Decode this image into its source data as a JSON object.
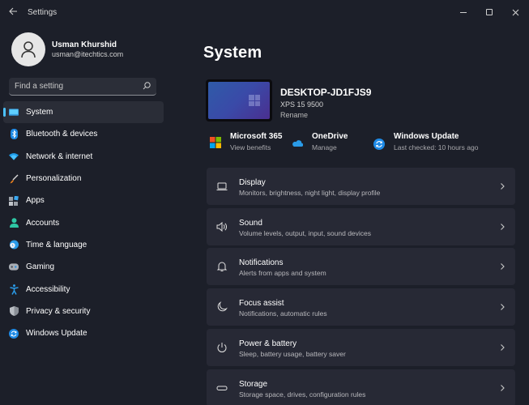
{
  "window": {
    "title": "Settings",
    "controls": {
      "minimize": "minimize",
      "maximize": "maximize",
      "close": "close"
    }
  },
  "profile": {
    "name": "Usman Khurshid",
    "email": "usman@itechtics.com"
  },
  "search": {
    "placeholder": "Find a setting",
    "value": ""
  },
  "sidebar": {
    "items": [
      {
        "label": "System",
        "icon": "system-display-icon",
        "active": true
      },
      {
        "label": "Bluetooth & devices",
        "icon": "bluetooth-icon"
      },
      {
        "label": "Network & internet",
        "icon": "wifi-icon"
      },
      {
        "label": "Personalization",
        "icon": "paintbrush-icon"
      },
      {
        "label": "Apps",
        "icon": "apps-icon"
      },
      {
        "label": "Accounts",
        "icon": "accounts-icon"
      },
      {
        "label": "Time & language",
        "icon": "globe-clock-icon"
      },
      {
        "label": "Gaming",
        "icon": "gamepad-icon"
      },
      {
        "label": "Accessibility",
        "icon": "accessibility-icon"
      },
      {
        "label": "Privacy & security",
        "icon": "shield-icon"
      },
      {
        "label": "Windows Update",
        "icon": "update-icon"
      }
    ]
  },
  "main": {
    "title": "System",
    "device": {
      "name": "DESKTOP-JD1FJS9",
      "model": "XPS 15 9500",
      "rename_label": "Rename"
    },
    "quick_links": [
      {
        "title": "Microsoft 365",
        "subtitle": "View benefits",
        "icon": "microsoft-365-icon"
      },
      {
        "title": "OneDrive",
        "subtitle": "Manage",
        "icon": "onedrive-cloud-icon"
      },
      {
        "title": "Windows Update",
        "subtitle": "Last checked: 10 hours ago",
        "icon": "windows-update-icon"
      }
    ],
    "cards": [
      {
        "title": "Display",
        "subtitle": "Monitors, brightness, night light, display profile",
        "icon": "laptop-icon"
      },
      {
        "title": "Sound",
        "subtitle": "Volume levels, output, input, sound devices",
        "icon": "speaker-icon"
      },
      {
        "title": "Notifications",
        "subtitle": "Alerts from apps and system",
        "icon": "bell-icon"
      },
      {
        "title": "Focus assist",
        "subtitle": "Notifications, automatic rules",
        "icon": "moon-icon"
      },
      {
        "title": "Power & battery",
        "subtitle": "Sleep, battery usage, battery saver",
        "icon": "power-icon"
      },
      {
        "title": "Storage",
        "subtitle": "Storage space, drives, configuration rules",
        "icon": "storage-drive-icon"
      }
    ]
  },
  "colors": {
    "background": "#1c1f29",
    "card": "#272935",
    "accent": "#4cc2ff"
  }
}
